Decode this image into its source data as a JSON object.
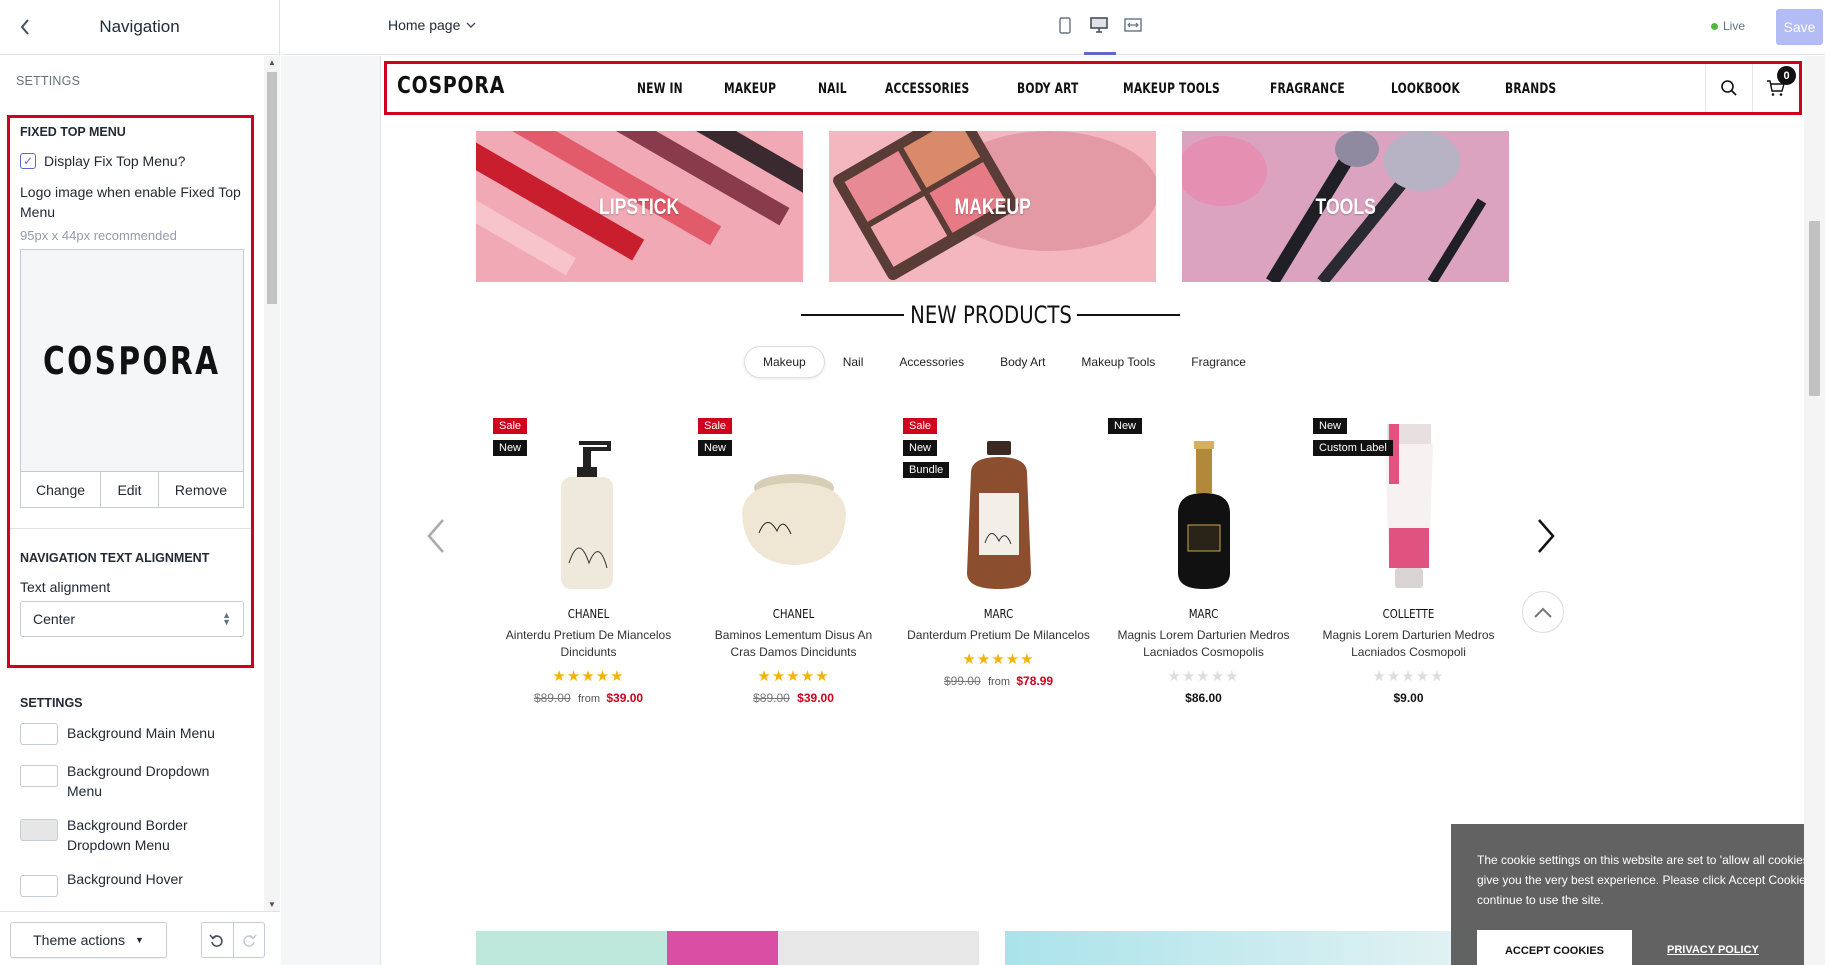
{
  "sidebar": {
    "back_icon": "chevron-left-icon",
    "title": "Navigation",
    "section_label": "SETTINGS",
    "fixed_top_menu": {
      "title": "FIXED TOP MENU",
      "checkbox_label": "Display Fix Top Menu?",
      "checkbox_checked": true,
      "logo_label": "Logo image when enable Fixed Top Menu",
      "logo_hint": "95px x 44px recommended",
      "logo_text": "COSPORA",
      "actions": [
        "Change",
        "Edit",
        "Remove"
      ]
    },
    "nav_alignment": {
      "title": "NAVIGATION TEXT ALIGNMENT",
      "label": "Text alignment",
      "value": "Center"
    },
    "settings2": {
      "title": "SETTINGS",
      "swatches": [
        {
          "label": "Background Main Menu",
          "color": "#ffffff"
        },
        {
          "label": "Background Dropdown Menu",
          "color": "#ffffff"
        },
        {
          "label": "Background Border Dropdown Menu",
          "color": "#e6e6e6"
        },
        {
          "label": "Background Hover",
          "color": "#ffffff"
        }
      ]
    },
    "footer": {
      "theme_actions": "Theme actions"
    }
  },
  "topbar": {
    "page": "Home page",
    "live": "Live",
    "save": "Save"
  },
  "store": {
    "logo": "COSPORA",
    "nav": [
      "NEW IN",
      "MAKEUP",
      "NAIL",
      "ACCESSORIES",
      "BODY ART",
      "MAKEUP TOOLS",
      "FRAGRANCE",
      "LOOKBOOK",
      "BRANDS"
    ],
    "cart_count": "0",
    "banners": [
      "LIPSTICK",
      "MAKEUP",
      "TOOLS"
    ],
    "section_title": "NEW PRODUCTS",
    "tabs": [
      "Makeup",
      "Nail",
      "Accessories",
      "Body Art",
      "Makeup Tools",
      "Fragrance"
    ],
    "products": [
      {
        "brand": "CHANEL",
        "name": "Ainterdu Pretium De Miancelos Dincidunts",
        "badges": [
          "Sale",
          "New"
        ],
        "rating": 5,
        "old": "$89.00",
        "from": "from",
        "price": "$39.00"
      },
      {
        "brand": "CHANEL",
        "name": "Baminos Lementum Disus An Cras Damos Dincidunts",
        "badges": [
          "Sale",
          "New"
        ],
        "rating": 5,
        "old": "$89.00",
        "from": "",
        "price": "$39.00"
      },
      {
        "brand": "MARC",
        "name": "Danterdum Pretium De Milancelos",
        "badges": [
          "Sale",
          "New",
          "Bundle"
        ],
        "rating": 5,
        "old": "$99.00",
        "from": "from",
        "price": "$78.99"
      },
      {
        "brand": "MARC",
        "name": "Magnis Lorem Darturien Medros Lacniados Cosmopolis",
        "badges": [
          "New"
        ],
        "rating": 0,
        "old": "",
        "from": "",
        "price": "$86.00"
      },
      {
        "brand": "COLLETTE",
        "name": "Magnis Lorem Darturien Medros Lacniados Cosmopoli",
        "badges": [
          "New",
          "Custom Label"
        ],
        "rating": 0,
        "old": "",
        "from": "",
        "price": "$9.00"
      }
    ]
  },
  "cookie": {
    "text": "The cookie settings on this website are set to 'allow all cookies' to give you the very best experience. Please click Accept Cookies to continue to use the site.",
    "accept": "ACCEPT COOKIES",
    "privacy": "PRIVACY POLICY"
  }
}
